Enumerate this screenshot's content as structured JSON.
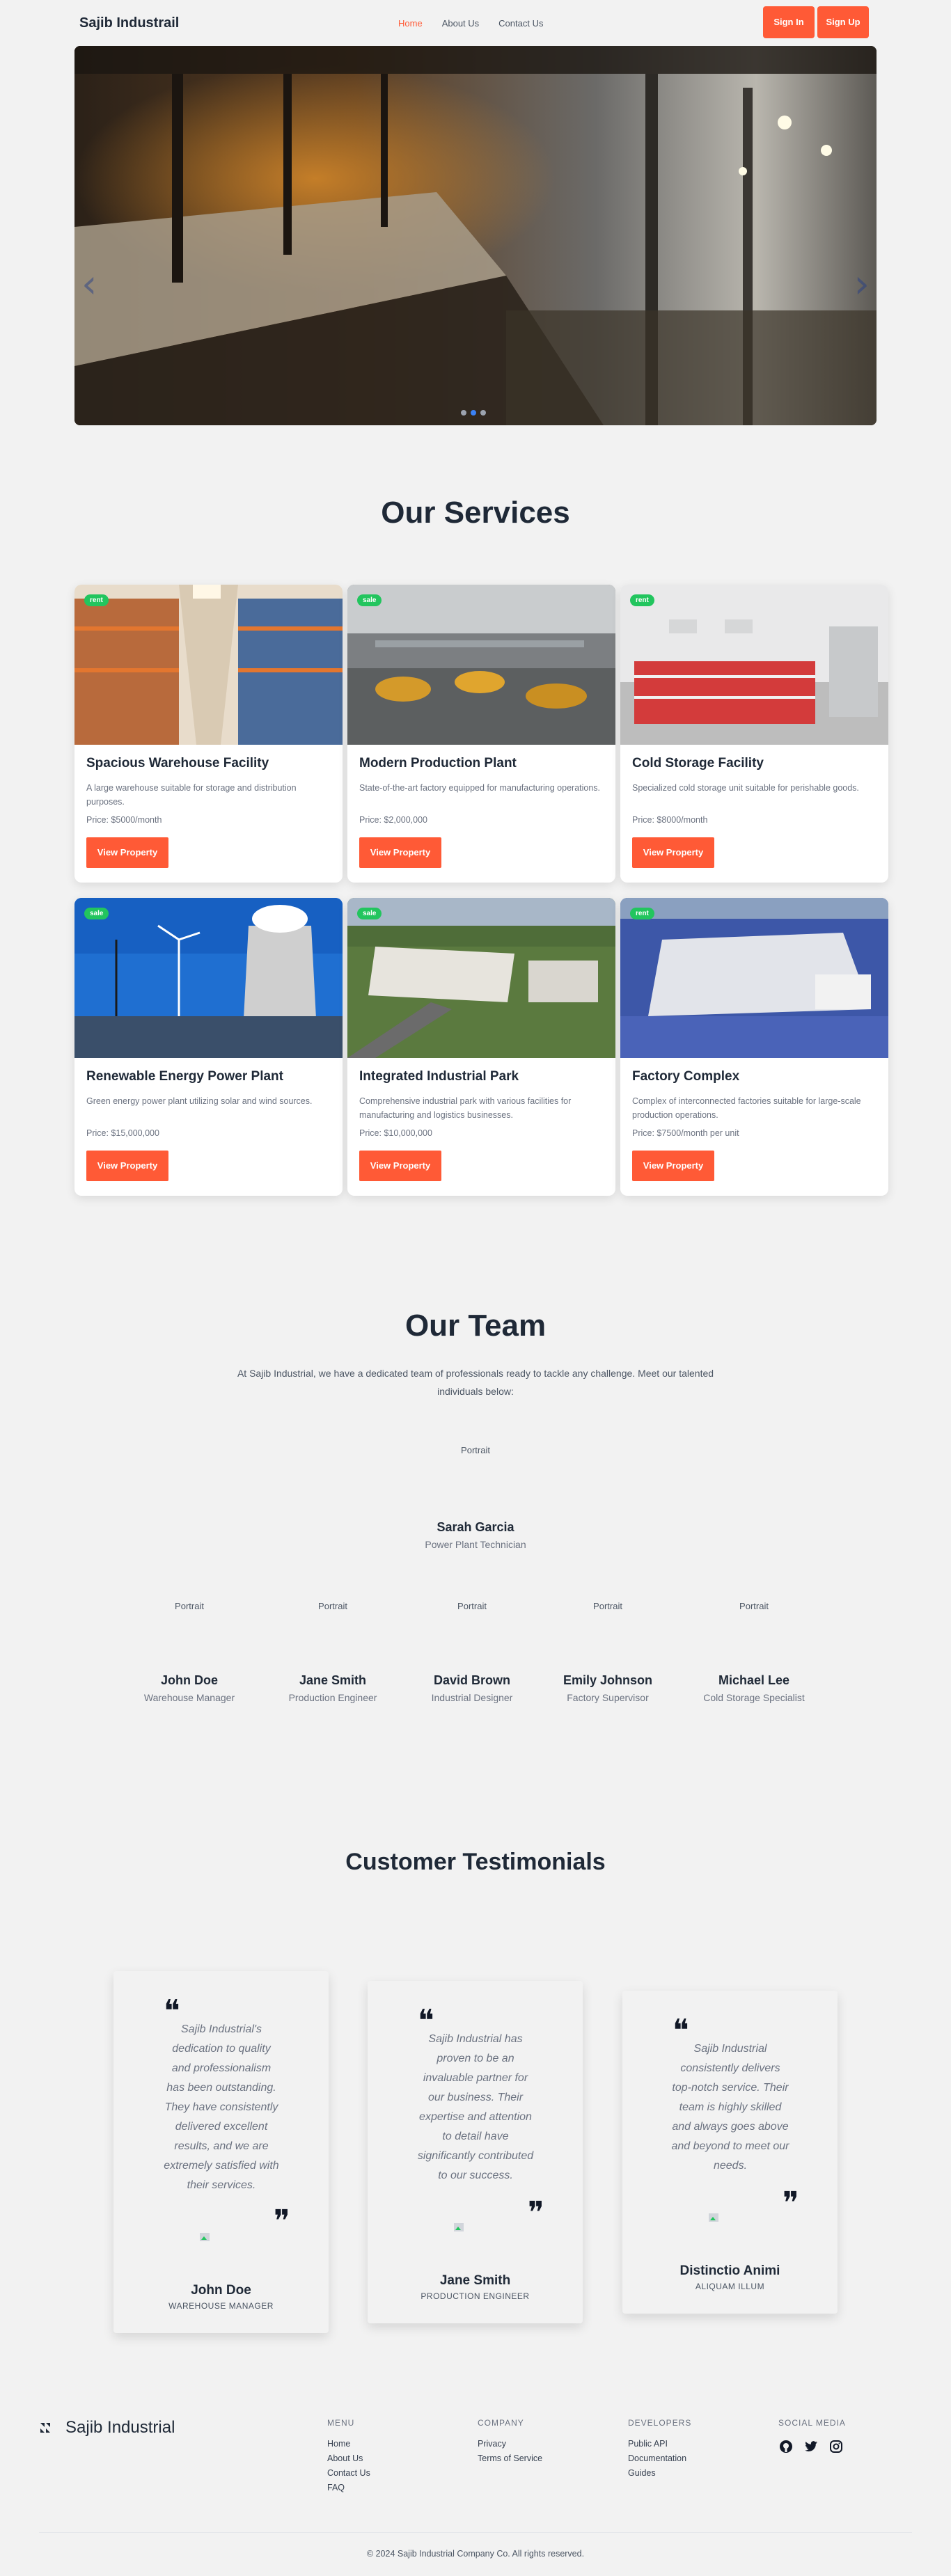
{
  "nav": {
    "brand": "Sajib Industrail",
    "links": [
      "Home",
      "About Us",
      "Contact Us"
    ],
    "sign_in": "Sign In",
    "sign_up": "Sign Up"
  },
  "hero": {
    "slides": 3,
    "active_slide": 2
  },
  "services": {
    "title": "Our Services",
    "view_label": "View Property",
    "items": [
      {
        "badge": "rent",
        "title": "Spacious Warehouse Facility",
        "desc": "A large warehouse suitable for storage and distribution purposes.",
        "price": "Price: $5000/month"
      },
      {
        "badge": "sale",
        "title": "Modern Production Plant",
        "desc": "State-of-the-art factory equipped for manufacturing operations.",
        "price": "Price: $2,000,000"
      },
      {
        "badge": "rent",
        "title": "Cold Storage Facility",
        "desc": "Specialized cold storage unit suitable for perishable goods.",
        "price": "Price: $8000/month"
      },
      {
        "badge": "sale",
        "title": "Renewable Energy Power Plant",
        "desc": "Green energy power plant utilizing solar and wind sources.",
        "price": "Price: $15,000,000"
      },
      {
        "badge": "sale",
        "title": "Integrated Industrial Park",
        "desc": "Comprehensive industrial park with various facilities for manufacturing and logistics businesses.",
        "price": "Price: $10,000,000"
      },
      {
        "badge": "rent",
        "title": "Factory Complex",
        "desc": "Complex of interconnected factories suitable for large-scale production operations.",
        "price": "Price: $7500/month per unit"
      }
    ]
  },
  "team": {
    "title": "Our Team",
    "intro": "At Sajib Industrial, we have a dedicated team of professionals ready to tackle any challenge. Meet our talented individuals below:",
    "portrait_alt": "Portrait",
    "lead": {
      "name": "Sarah Garcia",
      "role": "Power Plant Technician"
    },
    "members": [
      {
        "name": "John Doe",
        "role": "Warehouse Manager"
      },
      {
        "name": "Jane Smith",
        "role": "Production Engineer"
      },
      {
        "name": "David Brown",
        "role": "Industrial Designer"
      },
      {
        "name": "Emily Johnson",
        "role": "Factory Supervisor"
      },
      {
        "name": "Michael Lee",
        "role": "Cold Storage Specialist"
      }
    ]
  },
  "testimonials": {
    "title": "Customer Testimonials",
    "items": [
      {
        "quote": "Sajib Industrial's dedication to quality and professionalism has been outstanding. They have consistently delivered excellent results, and we are extremely satisfied with their services.",
        "name": "John Doe",
        "role": "WAREHOUSE MANAGER"
      },
      {
        "quote": "Sajib Industrial has proven to be an invaluable partner for our business. Their expertise and attention to detail have significantly contributed to our success.",
        "name": "Jane Smith",
        "role": "PRODUCTION ENGINEER"
      },
      {
        "quote": "Sajib Industrial consistently delivers top-notch service. Their team is highly skilled and always goes above and beyond to meet our needs.",
        "name": "Distinctio Animi",
        "role": "ALIQUAM ILLUM"
      }
    ]
  },
  "footer": {
    "brand": "Sajib Industrial",
    "menu": {
      "heading": "MENU",
      "links": [
        "Home",
        "About Us",
        "Contact Us",
        "FAQ"
      ]
    },
    "company": {
      "heading": "COMPANY",
      "links": [
        "Privacy",
        "Terms of Service"
      ]
    },
    "developers": {
      "heading": "DEVELOPERS",
      "links": [
        "Public API",
        "Documentation",
        "Guides"
      ]
    },
    "social": {
      "heading": "SOCIAL MEDIA",
      "icons": [
        "github-icon",
        "twitter-icon",
        "instagram-icon"
      ]
    },
    "copyright": "© 2024 Sajib Industrial Company Co. All rights reserved."
  },
  "colors": {
    "accent": "#ff5a36",
    "badge": "#22c55e",
    "background": "#f2f2f2",
    "text": "#1f2937"
  }
}
